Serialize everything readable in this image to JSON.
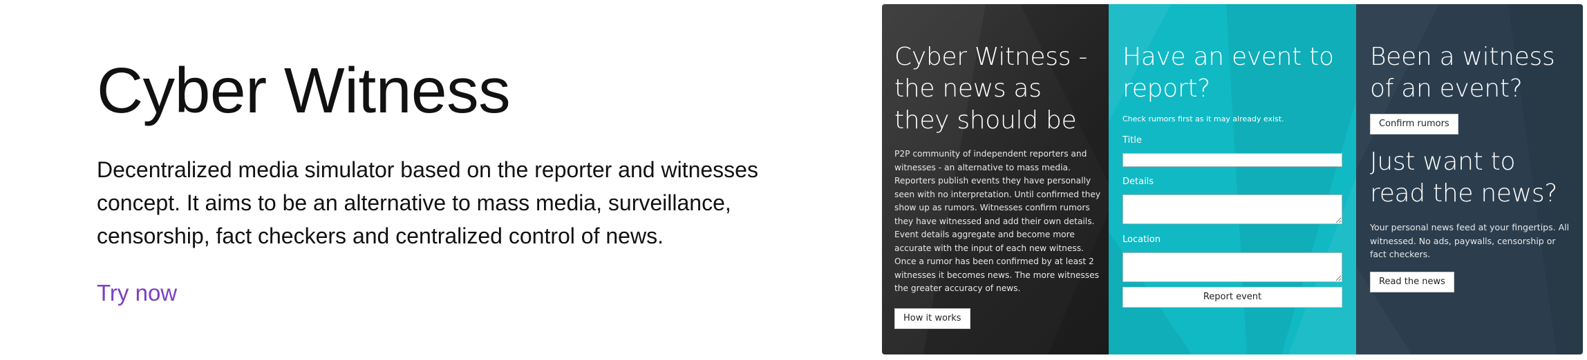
{
  "hero": {
    "title": "Cyber Witness",
    "description": "Decentralized media simulator based on the reporter and witnesses concept. It aims to be an alternative to mass media, surveillance, censorship, fact checkers and centralized control of news.",
    "cta": "Try now",
    "link_color": "#7b3fc4"
  },
  "preview": {
    "about": {
      "heading": "Cyber Witness - the news as they should be",
      "body": "P2P community of independent reporters and witnesses - an alternative to mass media. Reporters publish events they have personally seen with no interpretation. Until confirmed they show up as rumors. Witnesses confirm rumors they have witnessed and add their own details. Event details aggregate and become more accurate with the input of each new witness. Once a rumor has been confirmed by at least 2 witnesses it becomes news. The more witnesses the greater accuracy of news.",
      "button": "How it works",
      "bg_color": "#262626"
    },
    "report": {
      "heading": "Have an event to report?",
      "hint": "Check rumors first as it may already exist.",
      "title_label": "Title",
      "details_label": "Details",
      "location_label": "Location",
      "title_value": "",
      "details_value": "",
      "location_value": "",
      "button": "Report event",
      "bg_color": "#10b9c4"
    },
    "witness": {
      "heading": "Been a witness of an event?",
      "button": "Confirm rumors",
      "bg_color": "#2c3e4e"
    },
    "read": {
      "heading": "Just want to read the news?",
      "body": "Your personal news feed at your fingertips. All witnessed. No ads, paywalls, censorship or fact checkers.",
      "button": "Read the news"
    }
  }
}
